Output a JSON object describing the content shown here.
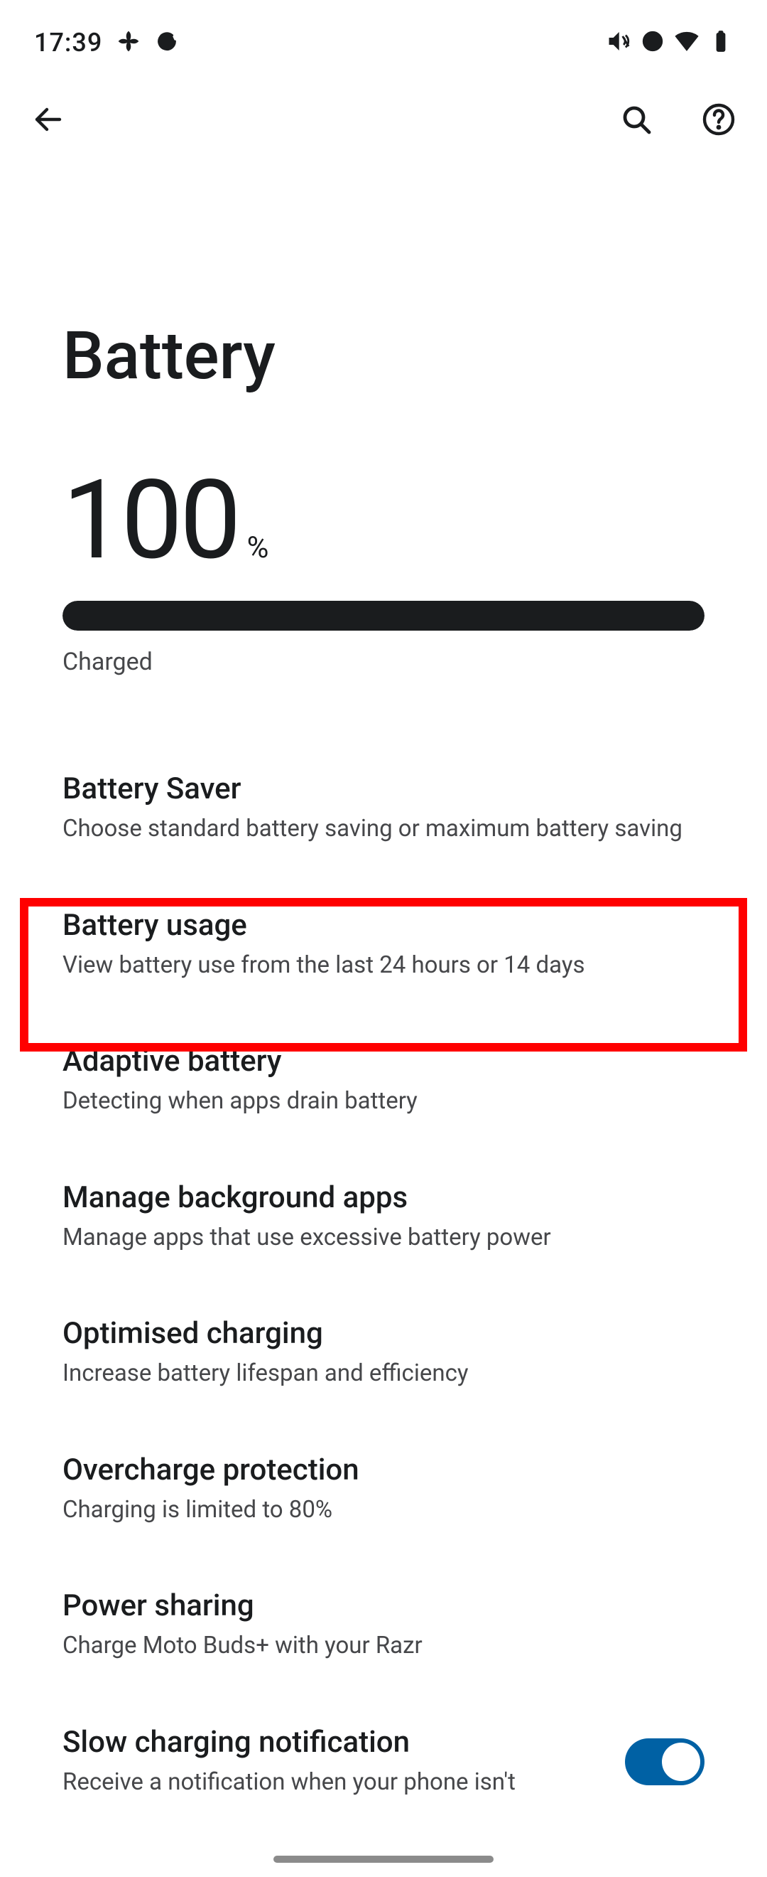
{
  "status": {
    "time": "17:39"
  },
  "page": {
    "title": "Battery"
  },
  "battery": {
    "value": "100",
    "percent_symbol": "%",
    "status": "Charged",
    "fill_percent": 100
  },
  "items": [
    {
      "title": "Battery Saver",
      "sub": "Choose standard battery saving or maximum battery saving"
    },
    {
      "title": "Battery usage",
      "sub": "View battery use from the last 24 hours or 14 days"
    },
    {
      "title": "Adaptive battery",
      "sub": "Detecting when apps drain battery"
    },
    {
      "title": "Manage background apps",
      "sub": "Manage apps that use excessive battery power"
    },
    {
      "title": "Optimised charging",
      "sub": "Increase battery lifespan and efficiency"
    },
    {
      "title": "Overcharge protection",
      "sub": "Charging is limited to 80%"
    },
    {
      "title": "Power sharing",
      "sub": "Charge Moto Buds+ with your Razr"
    },
    {
      "title": "Slow charging notification",
      "sub": "Receive a notification when your phone isn't"
    }
  ]
}
